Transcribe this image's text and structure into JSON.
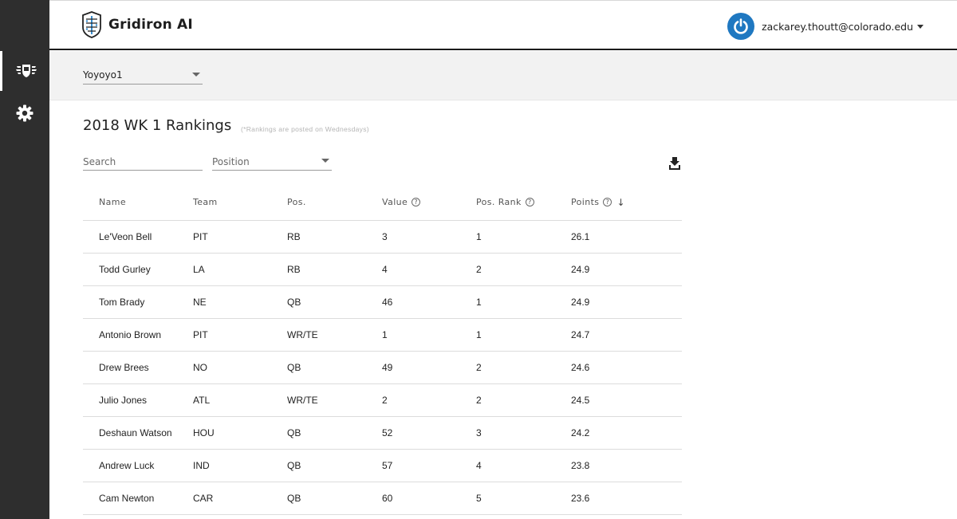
{
  "app": {
    "name": "Gridiron AI"
  },
  "account": {
    "email": "zackarey.thoutt@colorado.edu"
  },
  "team_select": {
    "value": "Yoyoyo1"
  },
  "page": {
    "title": "2018 WK 1 Rankings",
    "note": "(*Rankings are posted on Wednesdays)"
  },
  "filters": {
    "search_placeholder": "Search",
    "position_placeholder": "Position"
  },
  "sidebar": {
    "items": [
      {
        "icon": "team-shield-icon"
      },
      {
        "icon": "gear-icon"
      }
    ]
  },
  "table": {
    "headers": {
      "name": "Name",
      "team": "Team",
      "pos": "Pos.",
      "value": "Value",
      "pos_rank": "Pos. Rank",
      "points": "Points"
    },
    "help_glyph": "?",
    "sort_glyph": "↓",
    "rows": [
      {
        "name": "Le'Veon Bell",
        "team": "PIT",
        "pos": "RB",
        "value": "3",
        "pos_rank": "1",
        "points": "26.1"
      },
      {
        "name": "Todd Gurley",
        "team": "LA",
        "pos": "RB",
        "value": "4",
        "pos_rank": "2",
        "points": "24.9"
      },
      {
        "name": "Tom Brady",
        "team": "NE",
        "pos": "QB",
        "value": "46",
        "pos_rank": "1",
        "points": "24.9"
      },
      {
        "name": "Antonio Brown",
        "team": "PIT",
        "pos": "WR/TE",
        "value": "1",
        "pos_rank": "1",
        "points": "24.7"
      },
      {
        "name": "Drew Brees",
        "team": "NO",
        "pos": "QB",
        "value": "49",
        "pos_rank": "2",
        "points": "24.6"
      },
      {
        "name": "Julio Jones",
        "team": "ATL",
        "pos": "WR/TE",
        "value": "2",
        "pos_rank": "2",
        "points": "24.5"
      },
      {
        "name": "Deshaun Watson",
        "team": "HOU",
        "pos": "QB",
        "value": "52",
        "pos_rank": "3",
        "points": "24.2"
      },
      {
        "name": "Andrew Luck",
        "team": "IND",
        "pos": "QB",
        "value": "57",
        "pos_rank": "4",
        "points": "23.8"
      },
      {
        "name": "Cam Newton",
        "team": "CAR",
        "pos": "QB",
        "value": "60",
        "pos_rank": "5",
        "points": "23.6"
      }
    ]
  },
  "colors": {
    "sidebar": "#2e2e2e",
    "accent": "#1f78c1",
    "subbar": "#f2f2f2"
  }
}
